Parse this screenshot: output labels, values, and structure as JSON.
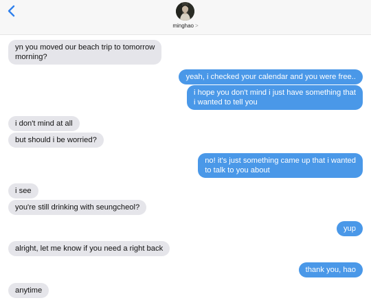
{
  "header": {
    "contact_name": "minghao",
    "contact_chevron": ">",
    "back_icon": "chevron-left-icon",
    "avatar": "contact-avatar"
  },
  "colors": {
    "sent_bubble": "#4a98e8",
    "received_bubble": "#e5e5ea",
    "accent": "#2f80ed"
  },
  "messages": [
    {
      "sender": "them",
      "lines": [
        "yn you moved our beach trip to tomorrow",
        "morning?"
      ]
    },
    {
      "sender": "me",
      "lines": [
        "yeah, i checked your calendar and you were free.."
      ]
    },
    {
      "sender": "me",
      "lines": [
        "i hope you don't mind i just have something that",
        "i wanted to tell you"
      ]
    },
    {
      "sender": "them",
      "lines": [
        "i don't mind at all"
      ]
    },
    {
      "sender": "them",
      "lines": [
        "but should i be worried?"
      ]
    },
    {
      "sender": "me",
      "lines": [
        "no! it's just something came up that i wanted",
        "to talk to you about"
      ]
    },
    {
      "sender": "them",
      "lines": [
        "i see"
      ]
    },
    {
      "sender": "them",
      "lines": [
        "you're still drinking with seungcheol?"
      ]
    },
    {
      "sender": "me",
      "lines": [
        "yup"
      ]
    },
    {
      "sender": "them",
      "lines": [
        "alright, let me know if you need a right back"
      ]
    },
    {
      "sender": "me",
      "lines": [
        "thank you, hao"
      ]
    },
    {
      "sender": "them",
      "lines": [
        "anytime"
      ]
    }
  ]
}
